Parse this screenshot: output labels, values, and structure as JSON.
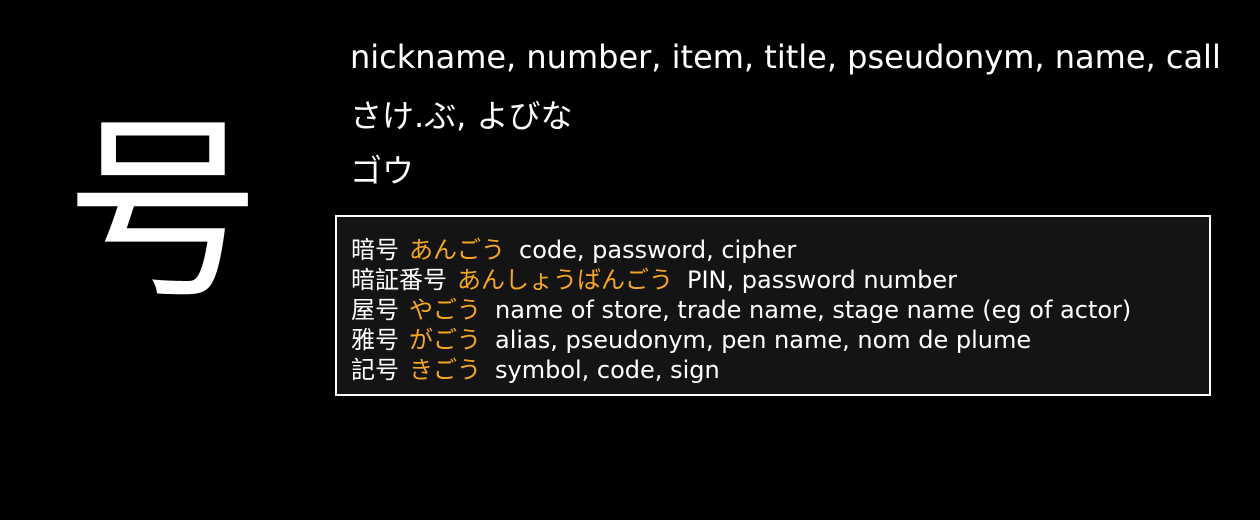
{
  "kanji": "号",
  "meanings": "nickname, number, item, title, pseudonym, name, call",
  "kun_readings": "さけ.ぶ, よびな",
  "on_readings": "ゴウ",
  "colors": {
    "background": "#000000",
    "text": "#ffffff",
    "reading_accent": "#f5a623",
    "panel_background": "#141414",
    "panel_border": "#ffffff"
  },
  "examples": [
    {
      "word": "暗号",
      "reading": "あんごう",
      "meaning": "code, password, cipher"
    },
    {
      "word": "暗証番号",
      "reading": "あんしょうばんごう",
      "meaning": "PIN, password number"
    },
    {
      "word": "屋号",
      "reading": "やごう",
      "meaning": "name of store, trade name, stage name (eg of actor)"
    },
    {
      "word": "雅号",
      "reading": "がごう",
      "meaning": "alias, pseudonym, pen name, nom de plume"
    },
    {
      "word": "記号",
      "reading": "きごう",
      "meaning": "symbol, code, sign"
    }
  ]
}
